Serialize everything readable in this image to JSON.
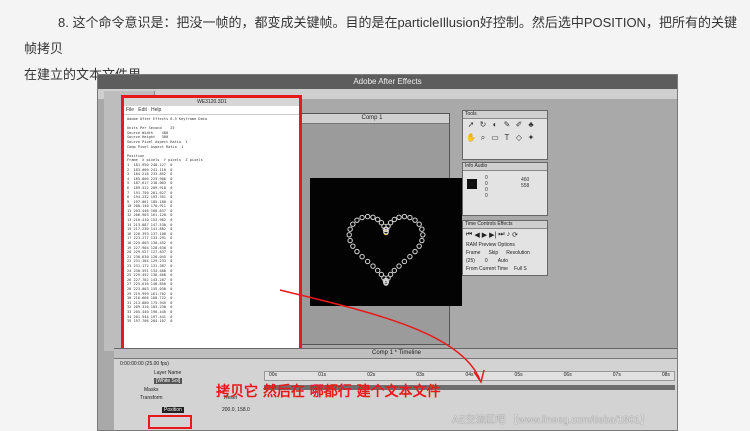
{
  "article": {
    "line1": "8. 这个命令意识是：把没一帧的，都变成关键帧。目的是在particleIllusion好控制。然后选中POSITION，把所有的关键帧拷贝",
    "line2": "在建立的文本文件里。"
  },
  "screenshot": {
    "app_title": "Adobe After Effects",
    "comp_window_title": "Comp 1",
    "timeline_title": "Comp 1 * Timeline",
    "tools_title": "Tools",
    "info_tabs": "Info  Audio",
    "info_values": [
      "0",
      "0",
      "0",
      "0",
      "460",
      "558"
    ],
    "time_tabs": "Time Controls  Effects",
    "ram_preview": "RAM Preview Options",
    "frame_rate_label": "Frame",
    "skip_label": "Skip",
    "resolution_label": "Resolution",
    "frame_rate_value": "(25)",
    "skip_value": "0",
    "resolution_value": "Auto",
    "from_current": "From Current Time",
    "full_screen": "Full S",
    "script_title": "WE3120.3D1",
    "script_menu": [
      "File",
      "Edit",
      "Help"
    ],
    "script_header": "Adobe After Effects 6.5 Keyframe Data",
    "script_props": [
      "Units Per Second    25",
      "Source Width    400",
      "Source Height   300",
      "Source Pixel Aspect Ratio  1",
      "Comp Pixel Aspect Ratio  1"
    ],
    "script_section": "Position",
    "script_columns": "Frame  X pixels  Y pixels  Z pixels",
    "script_rows": [
      "1  181.950 248.127  0",
      "2  183.000 241.110  0",
      "3  184.218 233.852  0",
      "4  185.800 225.906  0",
      "5  187.617 218.003  0",
      "6  189.512 209.918  0",
      "7  191.750 201.627  0",
      "8  194.232 193.351  0",
      "9  197.061 185.180  0",
      "10 200.140 176.911  0",
      "11 203.446 168.837  0",
      "12 206.903 161.120  0",
      "13 210.410 153.982  0",
      "14 213.887 147.530  0",
      "15 217.230 141.882  0",
      "16 220.393 137.108  0",
      "17 223.277 133.291  0",
      "18 225.803 130.452  0",
      "19 227.904 128.630  0",
      "20 229.527 127.837  0",
      "21 230.630 128.045  0",
      "22 231.184 129.233  0",
      "23 231.172 131.387  0",
      "24 230.591 134.480  0",
      "25 229.452 138.468  0",
      "26 227.782 143.287  0",
      "27 225.616 148.850  0",
      "28 223.003 155.030  0",
      "29 219.999 161.702  0",
      "30 216.666 168.722  0",
      "31 213.080 175.945  0",
      "32 209.310 183.230  0",
      "33 205.440 190.440  0",
      "34 201.544 197.441  0",
      "35 197.706 204.107  0"
    ],
    "timeline_time": "0:00:00:00 (25.00 fps)",
    "layer_name_header": "Layer Name",
    "layer_name": "[White Sol]",
    "masks_label": "Masks",
    "transform_label": "Transform",
    "reset_label": "Reset",
    "position_label": "Position",
    "position_value": "200.0, 158.0",
    "time_ruler_markers": [
      "00s",
      "01s",
      "02s",
      "03s",
      "04s",
      "05s",
      "06s",
      "07s",
      "08s"
    ]
  },
  "annotation_text": "拷贝它  然后在  哪都行  建个文本文件",
  "watermark_text": "AE交流区吧 【www.lineeg.com/tieba/1801】",
  "colors": {
    "highlight": "#e81919",
    "comp_background": "#030303"
  }
}
